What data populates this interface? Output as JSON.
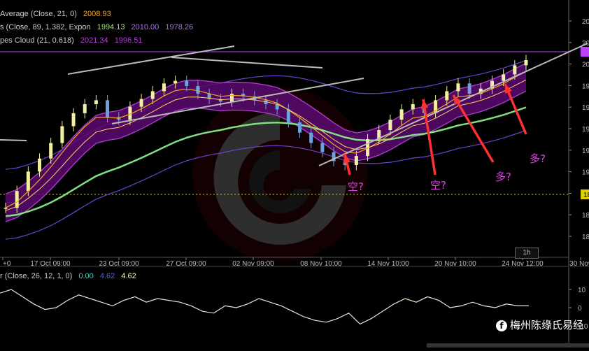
{
  "legend": {
    "line1_label": "Average (Close, 21, 0)",
    "line1_value": "2008.93",
    "line2_label": "s (Close, 89, 1.382, Expon",
    "line2_v1": "1994.13",
    "line2_v2": "2010.00",
    "line2_v3": "1978.26",
    "line3_label": "pes Cloud (21, 0.618)",
    "line3_v1": "2021.34",
    "line3_v2": "1996.51",
    "osc_label": "r (Close, 26, 12, 1, 0)",
    "osc_v1": "0.00",
    "osc_v2": "4.62",
    "osc_v3": "4.62"
  },
  "timeframe": "1h",
  "watermark": "梅州陈缘氏易经",
  "colors": {
    "price_up": "#f0f0a0",
    "price_down": "#6fa0e0",
    "ma_orange": "#f5a623",
    "band_purple": "#b040d0",
    "cloud_purple": "#5a0a70",
    "ma_green": "#80e080",
    "envelope_violet": "#7040d0",
    "trendline": "#bbbbbb",
    "arrow": "#ff3030",
    "annotation": "#e040e0",
    "level_line": "#c040ff"
  },
  "chart_data": [
    {
      "type": "line",
      "title": "",
      "x_tick_labels": [
        "+0",
        "17 Oct 09:00",
        "23 Oct 09:00",
        "27 Oct 09:00",
        "02 Nov 09:00",
        "08 Nov 10:00",
        "14 Nov 10:00",
        "20 Nov 10:00",
        "24 Nov 12:00",
        "30 Nov"
      ],
      "y_tick_labels": [
        "20",
        "20",
        "20",
        "19",
        "19",
        "19",
        "19",
        "19",
        "18",
        "18",
        "18"
      ],
      "y_marker": "18",
      "series": [
        {
          "name": "Close",
          "values": [
            1922,
            1935,
            1950,
            1960,
            1972,
            1985,
            1995,
            2002,
            2005,
            1992,
            1990,
            2000,
            2006,
            2012,
            2018,
            2020,
            2016,
            2010,
            2006,
            2004,
            2010,
            2008,
            2005,
            2002,
            1998,
            1988,
            1980,
            1972,
            1965,
            1958,
            1955,
            1962,
            1975,
            1982,
            1990,
            1998,
            2002,
            1995,
            2005,
            2012,
            2018,
            2010,
            2014,
            2020,
            2025,
            2032,
            2036
          ]
        }
      ],
      "annotations": [
        "空?",
        "空?",
        "多?",
        "多?"
      ]
    },
    {
      "type": "line",
      "title": "",
      "y_tick_labels": [
        "10",
        "0",
        "-10"
      ],
      "series": [
        {
          "name": "",
          "values": [
            8,
            10,
            6,
            2,
            -1,
            0,
            4,
            7,
            5,
            3,
            1,
            4,
            6,
            3,
            5,
            4,
            3,
            1,
            -2,
            -3,
            1,
            0,
            2,
            5,
            3,
            1,
            -2,
            -5,
            -7,
            -8,
            -6,
            -3,
            -9,
            -6,
            -2,
            2,
            5,
            3,
            6,
            4,
            0,
            1,
            3,
            1,
            0,
            2,
            1,
            1
          ]
        }
      ]
    }
  ]
}
